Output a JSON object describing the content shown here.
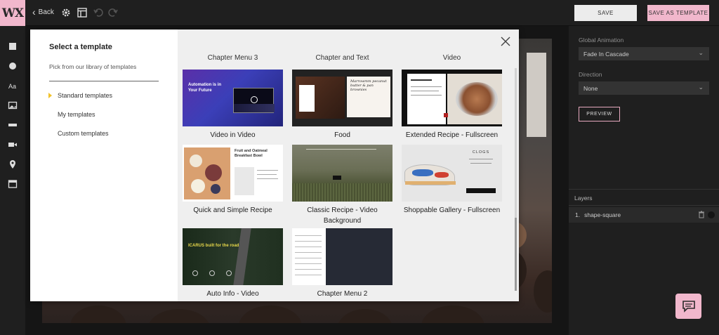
{
  "app": {
    "logo": "WX",
    "back_label": "Back",
    "save_label": "SAVE",
    "save_as_template_label": "SAVE AS TEMPLATE"
  },
  "left_tools": [
    "square-tool-icon",
    "circle-tool-icon",
    "text-tool-icon",
    "image-tool-icon",
    "divider-tool-icon",
    "video-tool-icon",
    "location-tool-icon",
    "layout-tool-icon"
  ],
  "right_panel": {
    "global_animation_label": "Global Animation",
    "global_animation_value": "Fade In Cascade",
    "direction_label": "Direction",
    "direction_value": "None",
    "preview_label": "PREVIEW",
    "layers_label": "Layers",
    "layers": [
      {
        "index": "1.",
        "name": "shape-square"
      }
    ]
  },
  "modal": {
    "title": "Select a template",
    "subtitle": "Pick from our library of templates",
    "categories": [
      "Standard templates",
      "My templates",
      "Custom templates"
    ],
    "cut_labels": [
      "Chapter Menu 3",
      "Chapter and Text",
      "Video"
    ],
    "templates": [
      {
        "label": "Video in Video",
        "thumb_text": "Automation is in Your Future"
      },
      {
        "label": "Food",
        "thumb_text": "Marrowmm pecanut butter & pan brownies"
      },
      {
        "label": "Extended Recipe - Fullscreen",
        "thumb_text": ""
      },
      {
        "label": "Quick and Simple Recipe",
        "thumb_text": "Fruit and Oatmeal Breakfast Bowl"
      },
      {
        "label": "Classic Recipe - Video Background",
        "thumb_text": ""
      },
      {
        "label": "Shoppable Gallery - Fullscreen",
        "thumb_text": "CLOGS"
      },
      {
        "label": "Auto Info - Video",
        "thumb_text": "ICARUS built for the road"
      },
      {
        "label": "Chapter Menu 2",
        "thumb_text": ""
      }
    ]
  },
  "colors": {
    "accent_pink": "#f1b7cc",
    "arrow_yellow": "#f2c22a",
    "dark_bg": "#1f1f1f"
  }
}
